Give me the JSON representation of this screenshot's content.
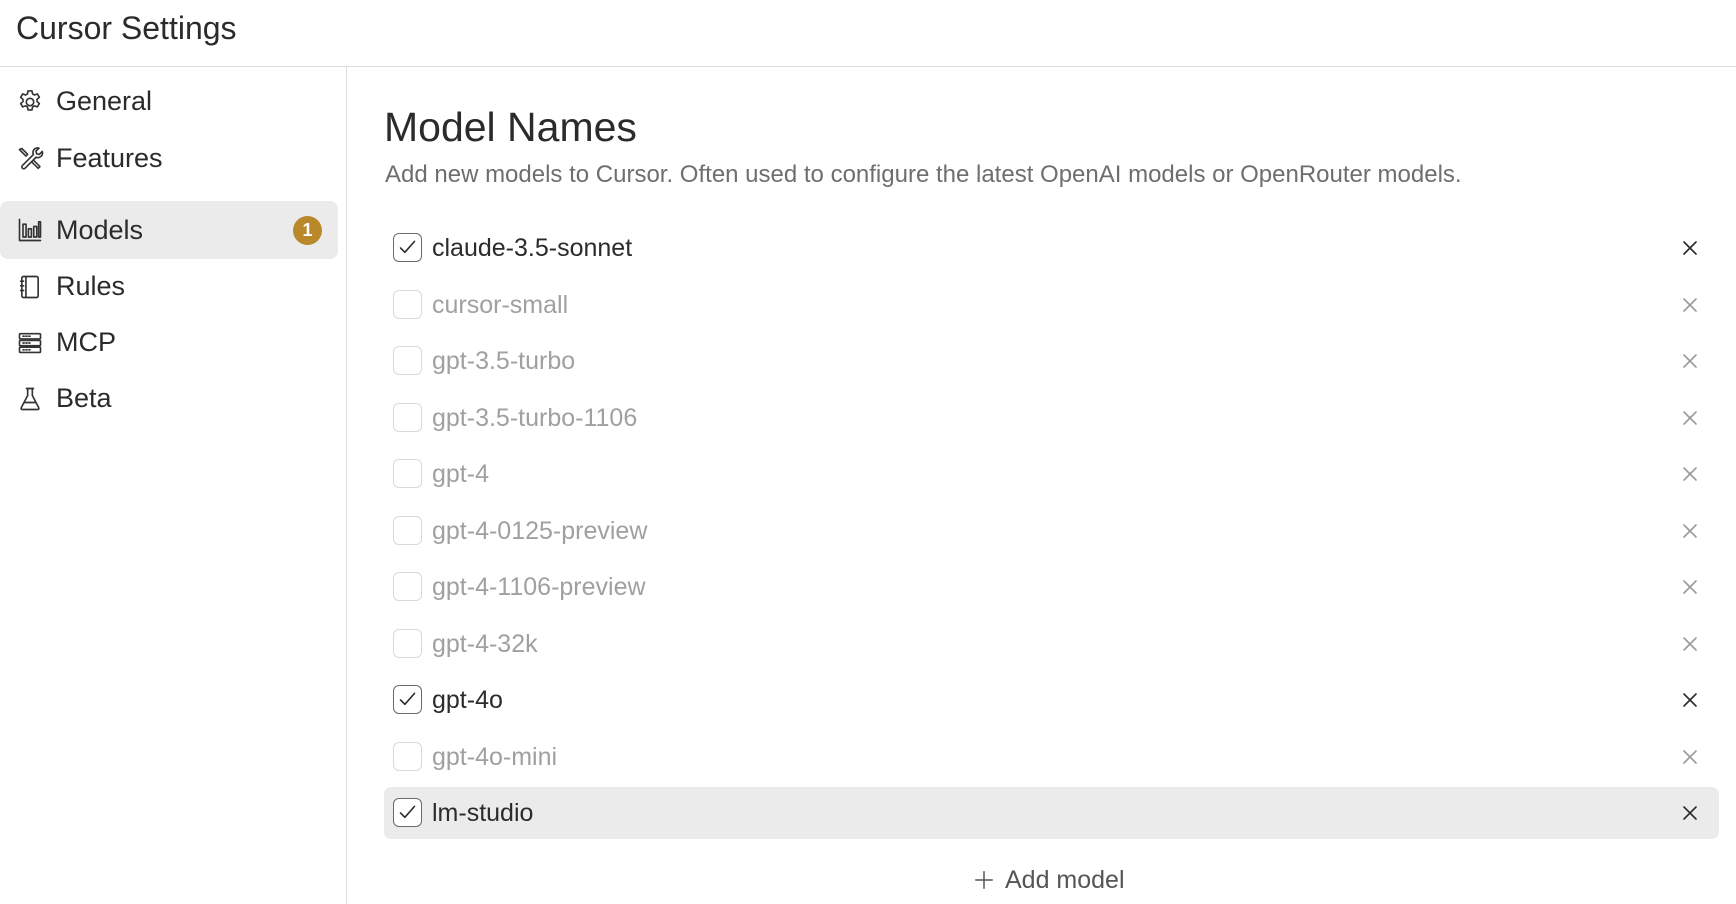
{
  "app": {
    "title": "Cursor Settings"
  },
  "sidebar": {
    "items": [
      {
        "label": "General",
        "icon": "gear-icon"
      },
      {
        "label": "Features",
        "icon": "tools-icon"
      },
      {
        "label": "Models",
        "icon": "bar-chart-icon",
        "badge": "1",
        "active": true
      },
      {
        "label": "Rules",
        "icon": "notebook-icon"
      },
      {
        "label": "MCP",
        "icon": "server-icon"
      },
      {
        "label": "Beta",
        "icon": "flask-icon"
      }
    ]
  },
  "main": {
    "title": "Model Names",
    "description": "Add new models to Cursor. Often used to configure the latest OpenAI models or OpenRouter models.",
    "models": [
      {
        "name": "claude-3.5-sonnet",
        "enabled": true
      },
      {
        "name": "cursor-small",
        "enabled": false
      },
      {
        "name": "gpt-3.5-turbo",
        "enabled": false
      },
      {
        "name": "gpt-3.5-turbo-1106",
        "enabled": false
      },
      {
        "name": "gpt-4",
        "enabled": false
      },
      {
        "name": "gpt-4-0125-preview",
        "enabled": false
      },
      {
        "name": "gpt-4-1106-preview",
        "enabled": false
      },
      {
        "name": "gpt-4-32k",
        "enabled": false
      },
      {
        "name": "gpt-4o",
        "enabled": true
      },
      {
        "name": "gpt-4o-mini",
        "enabled": false
      },
      {
        "name": "lm-studio",
        "enabled": true,
        "hovered": true
      }
    ],
    "add_label": "Add model"
  },
  "colors": {
    "badge": "#b8882a",
    "active_bg": "#ebebeb",
    "text_enabled": "#2b2b2b",
    "text_disabled": "#a0a0a0",
    "description": "#6e6e6e"
  }
}
